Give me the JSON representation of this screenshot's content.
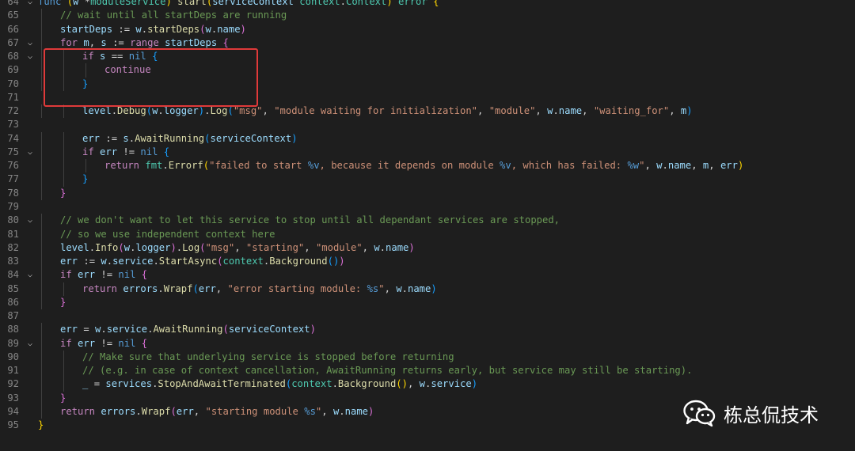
{
  "editor": {
    "lines": [
      {
        "n": "64",
        "fold": true,
        "indent": 0,
        "tokens": [
          [
            "kw",
            "func"
          ],
          [
            "pun",
            " "
          ],
          [
            "b1",
            "("
          ],
          [
            "var",
            "w"
          ],
          [
            "pun",
            " "
          ],
          [
            "op",
            "*"
          ],
          [
            "type",
            "moduleService"
          ],
          [
            "b1",
            ")"
          ],
          [
            "pun",
            " "
          ],
          [
            "fn",
            "start"
          ],
          [
            "b1",
            "("
          ],
          [
            "var",
            "serviceContext"
          ],
          [
            "pun",
            " "
          ],
          [
            "type",
            "context"
          ],
          [
            "pun",
            "."
          ],
          [
            "type",
            "Context"
          ],
          [
            "b1",
            ")"
          ],
          [
            "pun",
            " "
          ],
          [
            "type",
            "error"
          ],
          [
            "pun",
            " "
          ],
          [
            "b1",
            "{"
          ]
        ]
      },
      {
        "n": "65",
        "fold": false,
        "indent": 1,
        "tokens": [
          [
            "com",
            "// wait until all startDeps are running"
          ]
        ]
      },
      {
        "n": "66",
        "fold": false,
        "indent": 1,
        "tokens": [
          [
            "var",
            "startDeps"
          ],
          [
            "pun",
            " "
          ],
          [
            "op",
            ":="
          ],
          [
            "pun",
            " "
          ],
          [
            "var",
            "w"
          ],
          [
            "pun",
            "."
          ],
          [
            "fn",
            "startDeps"
          ],
          [
            "b2",
            "("
          ],
          [
            "var",
            "w"
          ],
          [
            "pun",
            "."
          ],
          [
            "var",
            "name"
          ],
          [
            "b2",
            ")"
          ]
        ]
      },
      {
        "n": "67",
        "fold": true,
        "indent": 1,
        "tokens": [
          [
            "ctrl",
            "for"
          ],
          [
            "pun",
            " "
          ],
          [
            "var",
            "m"
          ],
          [
            "pun",
            ", "
          ],
          [
            "var",
            "s"
          ],
          [
            "pun",
            " "
          ],
          [
            "op",
            ":="
          ],
          [
            "pun",
            " "
          ],
          [
            "ctrl",
            "range"
          ],
          [
            "pun",
            " "
          ],
          [
            "var",
            "startDeps"
          ],
          [
            "pun",
            " "
          ],
          [
            "b2",
            "{"
          ]
        ]
      },
      {
        "n": "68",
        "fold": true,
        "indent": 2,
        "tokens": [
          [
            "ctrl",
            "if"
          ],
          [
            "pun",
            " "
          ],
          [
            "var",
            "s"
          ],
          [
            "pun",
            " "
          ],
          [
            "op",
            "=="
          ],
          [
            "pun",
            " "
          ],
          [
            "kw",
            "nil"
          ],
          [
            "pun",
            " "
          ],
          [
            "b3",
            "{"
          ]
        ]
      },
      {
        "n": "69",
        "fold": false,
        "indent": 3,
        "tokens": [
          [
            "ctrl",
            "continue"
          ]
        ]
      },
      {
        "n": "70",
        "fold": false,
        "indent": 2,
        "tokens": [
          [
            "b3",
            "}"
          ]
        ]
      },
      {
        "n": "71",
        "fold": false,
        "indent": 0,
        "tokens": []
      },
      {
        "n": "72",
        "fold": false,
        "indent": 2,
        "tokens": [
          [
            "var",
            "level"
          ],
          [
            "pun",
            "."
          ],
          [
            "fn",
            "Debug"
          ],
          [
            "b3",
            "("
          ],
          [
            "var",
            "w"
          ],
          [
            "pun",
            "."
          ],
          [
            "var",
            "logger"
          ],
          [
            "b3",
            ")"
          ],
          [
            "pun",
            "."
          ],
          [
            "fn",
            "Log"
          ],
          [
            "b3",
            "("
          ],
          [
            "str",
            "\"msg\""
          ],
          [
            "pun",
            ", "
          ],
          [
            "str",
            "\"module waiting for initialization\""
          ],
          [
            "pun",
            ", "
          ],
          [
            "str",
            "\"module\""
          ],
          [
            "pun",
            ", "
          ],
          [
            "var",
            "w"
          ],
          [
            "pun",
            "."
          ],
          [
            "var",
            "name"
          ],
          [
            "pun",
            ", "
          ],
          [
            "str",
            "\"waiting_for\""
          ],
          [
            "pun",
            ", "
          ],
          [
            "var",
            "m"
          ],
          [
            "b3",
            ")"
          ]
        ]
      },
      {
        "n": "73",
        "fold": false,
        "indent": 0,
        "tokens": []
      },
      {
        "n": "74",
        "fold": false,
        "indent": 2,
        "tokens": [
          [
            "var",
            "err"
          ],
          [
            "pun",
            " "
          ],
          [
            "op",
            ":="
          ],
          [
            "pun",
            " "
          ],
          [
            "var",
            "s"
          ],
          [
            "pun",
            "."
          ],
          [
            "fn",
            "AwaitRunning"
          ],
          [
            "b3",
            "("
          ],
          [
            "var",
            "serviceContext"
          ],
          [
            "b3",
            ")"
          ]
        ]
      },
      {
        "n": "75",
        "fold": true,
        "indent": 2,
        "tokens": [
          [
            "ctrl",
            "if"
          ],
          [
            "pun",
            " "
          ],
          [
            "var",
            "err"
          ],
          [
            "pun",
            " "
          ],
          [
            "op",
            "!="
          ],
          [
            "pun",
            " "
          ],
          [
            "kw",
            "nil"
          ],
          [
            "pun",
            " "
          ],
          [
            "b3",
            "{"
          ]
        ]
      },
      {
        "n": "76",
        "fold": false,
        "indent": 3,
        "tokens": [
          [
            "ctrl",
            "return"
          ],
          [
            "pun",
            " "
          ],
          [
            "type",
            "fmt"
          ],
          [
            "pun",
            "."
          ],
          [
            "fn",
            "Errorf"
          ],
          [
            "b1",
            "("
          ],
          [
            "str",
            "\"failed to start "
          ],
          [
            "esc",
            "%v"
          ],
          [
            "str",
            ", because it depends on module "
          ],
          [
            "esc",
            "%v"
          ],
          [
            "str",
            ", which has failed: "
          ],
          [
            "esc",
            "%w"
          ],
          [
            "str",
            "\""
          ],
          [
            "pun",
            ", "
          ],
          [
            "var",
            "w"
          ],
          [
            "pun",
            "."
          ],
          [
            "var",
            "name"
          ],
          [
            "pun",
            ", "
          ],
          [
            "var",
            "m"
          ],
          [
            "pun",
            ", "
          ],
          [
            "var",
            "err"
          ],
          [
            "b1",
            ")"
          ]
        ]
      },
      {
        "n": "77",
        "fold": false,
        "indent": 2,
        "tokens": [
          [
            "b3",
            "}"
          ]
        ]
      },
      {
        "n": "78",
        "fold": false,
        "indent": 1,
        "tokens": [
          [
            "b2",
            "}"
          ]
        ]
      },
      {
        "n": "79",
        "fold": false,
        "indent": 0,
        "tokens": []
      },
      {
        "n": "80",
        "fold": true,
        "indent": 1,
        "tokens": [
          [
            "com",
            "// we don't want to let this service to stop until all dependant services are stopped,"
          ]
        ]
      },
      {
        "n": "81",
        "fold": false,
        "indent": 1,
        "tokens": [
          [
            "com",
            "// so we use independent context here"
          ]
        ]
      },
      {
        "n": "82",
        "fold": false,
        "indent": 1,
        "tokens": [
          [
            "var",
            "level"
          ],
          [
            "pun",
            "."
          ],
          [
            "fn",
            "Info"
          ],
          [
            "b2",
            "("
          ],
          [
            "var",
            "w"
          ],
          [
            "pun",
            "."
          ],
          [
            "var",
            "logger"
          ],
          [
            "b2",
            ")"
          ],
          [
            "pun",
            "."
          ],
          [
            "fn",
            "Log"
          ],
          [
            "b2",
            "("
          ],
          [
            "str",
            "\"msg\""
          ],
          [
            "pun",
            ", "
          ],
          [
            "str",
            "\"starting\""
          ],
          [
            "pun",
            ", "
          ],
          [
            "str",
            "\"module\""
          ],
          [
            "pun",
            ", "
          ],
          [
            "var",
            "w"
          ],
          [
            "pun",
            "."
          ],
          [
            "var",
            "name"
          ],
          [
            "b2",
            ")"
          ]
        ]
      },
      {
        "n": "83",
        "fold": false,
        "indent": 1,
        "tokens": [
          [
            "var",
            "err"
          ],
          [
            "pun",
            " "
          ],
          [
            "op",
            ":="
          ],
          [
            "pun",
            " "
          ],
          [
            "var",
            "w"
          ],
          [
            "pun",
            "."
          ],
          [
            "var",
            "service"
          ],
          [
            "pun",
            "."
          ],
          [
            "fn",
            "StartAsync"
          ],
          [
            "b2",
            "("
          ],
          [
            "type",
            "context"
          ],
          [
            "pun",
            "."
          ],
          [
            "fn",
            "Background"
          ],
          [
            "b3",
            "()"
          ],
          [
            "b2",
            ")"
          ]
        ]
      },
      {
        "n": "84",
        "fold": true,
        "indent": 1,
        "tokens": [
          [
            "ctrl",
            "if"
          ],
          [
            "pun",
            " "
          ],
          [
            "var",
            "err"
          ],
          [
            "pun",
            " "
          ],
          [
            "op",
            "!="
          ],
          [
            "pun",
            " "
          ],
          [
            "kw",
            "nil"
          ],
          [
            "pun",
            " "
          ],
          [
            "b2",
            "{"
          ]
        ]
      },
      {
        "n": "85",
        "fold": false,
        "indent": 2,
        "tokens": [
          [
            "ctrl",
            "return"
          ],
          [
            "pun",
            " "
          ],
          [
            "var",
            "errors"
          ],
          [
            "pun",
            "."
          ],
          [
            "fn",
            "Wrapf"
          ],
          [
            "b3",
            "("
          ],
          [
            "var",
            "err"
          ],
          [
            "pun",
            ", "
          ],
          [
            "str",
            "\"error starting module: "
          ],
          [
            "esc",
            "%s"
          ],
          [
            "str",
            "\""
          ],
          [
            "pun",
            ", "
          ],
          [
            "var",
            "w"
          ],
          [
            "pun",
            "."
          ],
          [
            "var",
            "name"
          ],
          [
            "b3",
            ")"
          ]
        ]
      },
      {
        "n": "86",
        "fold": false,
        "indent": 1,
        "tokens": [
          [
            "b2",
            "}"
          ]
        ]
      },
      {
        "n": "87",
        "fold": false,
        "indent": 0,
        "tokens": []
      },
      {
        "n": "88",
        "fold": false,
        "indent": 1,
        "tokens": [
          [
            "var",
            "err"
          ],
          [
            "pun",
            " "
          ],
          [
            "op",
            "="
          ],
          [
            "pun",
            " "
          ],
          [
            "var",
            "w"
          ],
          [
            "pun",
            "."
          ],
          [
            "var",
            "service"
          ],
          [
            "pun",
            "."
          ],
          [
            "fn",
            "AwaitRunning"
          ],
          [
            "b2",
            "("
          ],
          [
            "var",
            "serviceContext"
          ],
          [
            "b2",
            ")"
          ]
        ]
      },
      {
        "n": "89",
        "fold": true,
        "indent": 1,
        "tokens": [
          [
            "ctrl",
            "if"
          ],
          [
            "pun",
            " "
          ],
          [
            "var",
            "err"
          ],
          [
            "pun",
            " "
          ],
          [
            "op",
            "!="
          ],
          [
            "pun",
            " "
          ],
          [
            "kw",
            "nil"
          ],
          [
            "pun",
            " "
          ],
          [
            "b2",
            "{"
          ]
        ]
      },
      {
        "n": "90",
        "fold": false,
        "indent": 2,
        "tokens": [
          [
            "com",
            "// Make sure that underlying service is stopped before returning"
          ]
        ]
      },
      {
        "n": "91",
        "fold": false,
        "indent": 2,
        "tokens": [
          [
            "com",
            "// (e.g. in case of context cancellation, AwaitRunning returns early, but service may still be starting)."
          ]
        ]
      },
      {
        "n": "92",
        "fold": false,
        "indent": 2,
        "tokens": [
          [
            "var",
            "_"
          ],
          [
            "pun",
            " "
          ],
          [
            "op",
            "="
          ],
          [
            "pun",
            " "
          ],
          [
            "var",
            "services"
          ],
          [
            "pun",
            "."
          ],
          [
            "fn",
            "StopAndAwaitTerminated"
          ],
          [
            "b3",
            "("
          ],
          [
            "type",
            "context"
          ],
          [
            "pun",
            "."
          ],
          [
            "fn",
            "Background"
          ],
          [
            "b1",
            "()"
          ],
          [
            "pun",
            ", "
          ],
          [
            "var",
            "w"
          ],
          [
            "pun",
            "."
          ],
          [
            "var",
            "service"
          ],
          [
            "b3",
            ")"
          ]
        ]
      },
      {
        "n": "93",
        "fold": false,
        "indent": 1,
        "tokens": [
          [
            "b2",
            "}"
          ]
        ]
      },
      {
        "n": "94",
        "fold": false,
        "indent": 1,
        "tokens": [
          [
            "ctrl",
            "return"
          ],
          [
            "pun",
            " "
          ],
          [
            "var",
            "errors"
          ],
          [
            "pun",
            "."
          ],
          [
            "fn",
            "Wrapf"
          ],
          [
            "b2",
            "("
          ],
          [
            "var",
            "err"
          ],
          [
            "pun",
            ", "
          ],
          [
            "str",
            "\"starting module "
          ],
          [
            "esc",
            "%s"
          ],
          [
            "str",
            "\""
          ],
          [
            "pun",
            ", "
          ],
          [
            "var",
            "w"
          ],
          [
            "pun",
            "."
          ],
          [
            "var",
            "name"
          ],
          [
            "b2",
            ")"
          ]
        ]
      },
      {
        "n": "95",
        "fold": false,
        "indent": 0,
        "tokens": [
          [
            "b1",
            "}"
          ]
        ]
      }
    ]
  },
  "annotation": {
    "color": "#e03a3a"
  },
  "watermark": {
    "icon": "wechat-icon",
    "text": "栋总侃技术"
  }
}
